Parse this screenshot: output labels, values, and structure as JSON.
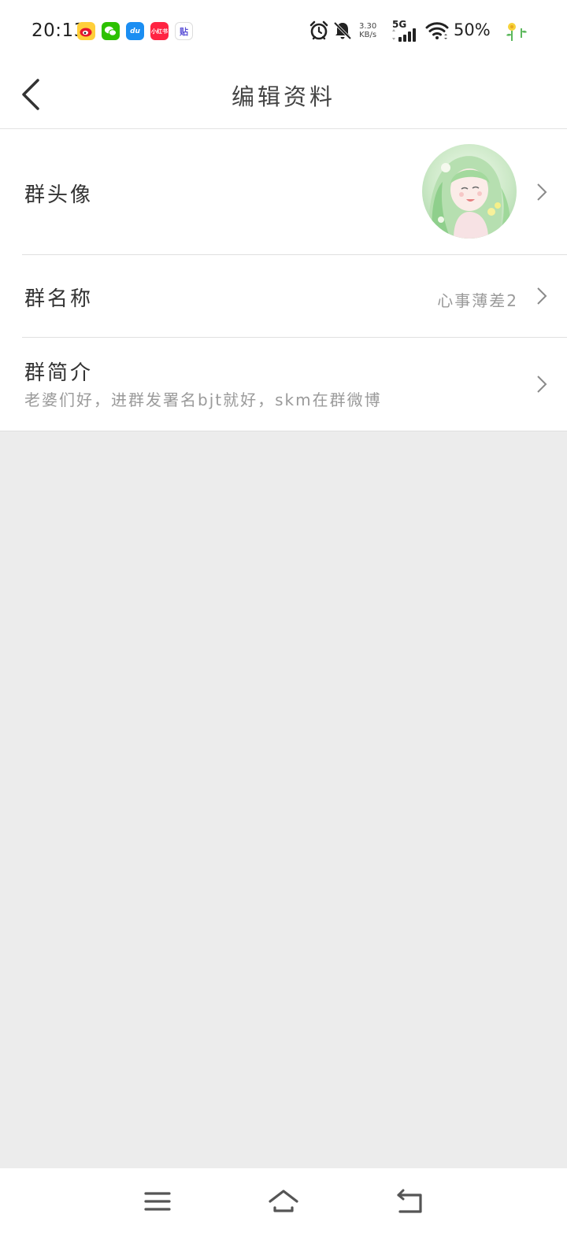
{
  "status_bar": {
    "time": "20:13",
    "net_speed_value": "3.30",
    "net_speed_unit": "KB/s",
    "network_type": "5G",
    "battery": "50%",
    "notification_apps": [
      "weibo-icon",
      "wechat-icon",
      "du-app-icon",
      "xiaohongshu-icon",
      "tieba-icon"
    ],
    "du_app_label": "du",
    "xhs_label": "小红书",
    "tieba_label": "贴"
  },
  "header": {
    "title": "编辑资料"
  },
  "rows": {
    "avatar": {
      "label": "群头像"
    },
    "name": {
      "label": "群名称",
      "value": "心事薄差2"
    },
    "intro": {
      "label": "群简介",
      "value": "老婆们好，进群发署名bjt就好，skm在群微博"
    }
  },
  "colors": {
    "background": "#ececec",
    "surface": "#ffffff",
    "text_primary": "#333333",
    "text_secondary": "#9a9a9a"
  }
}
